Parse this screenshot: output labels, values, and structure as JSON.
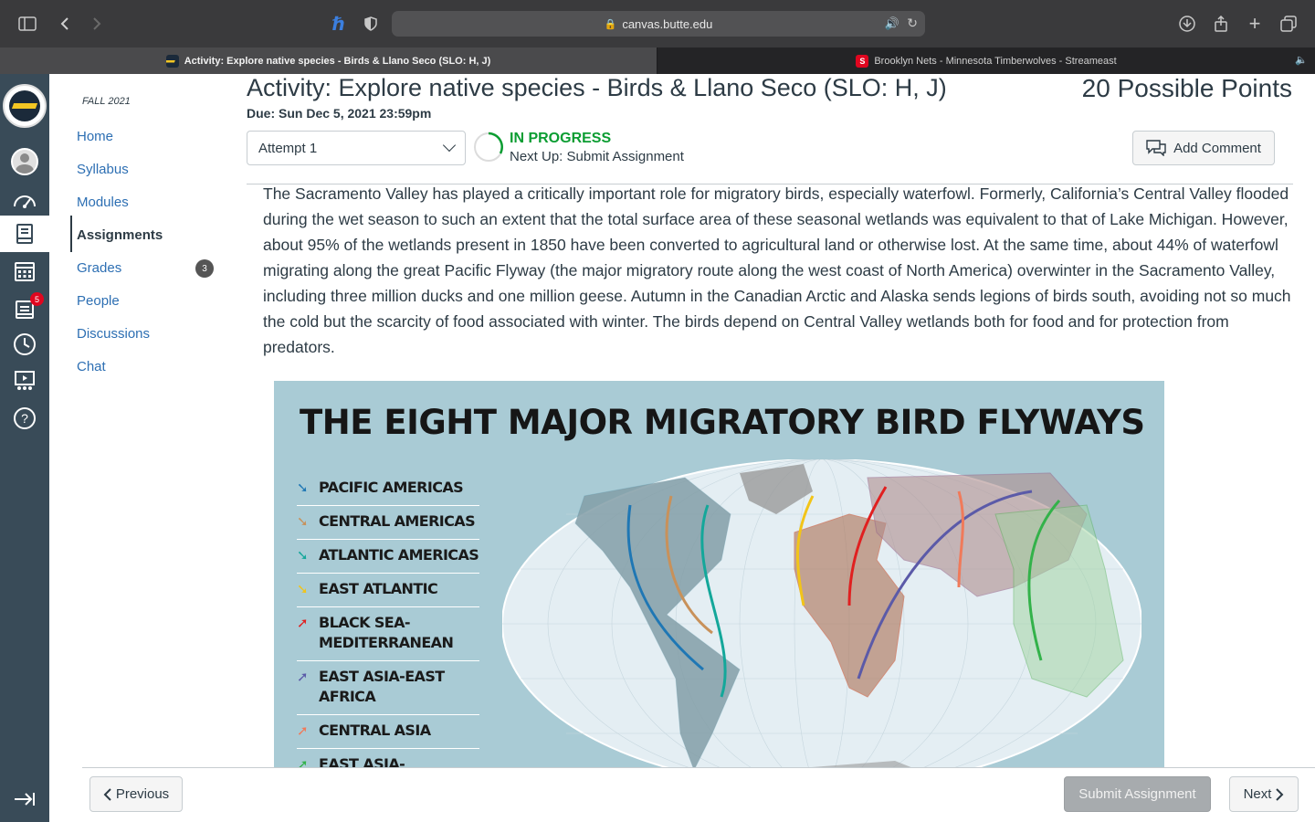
{
  "browser": {
    "url": "canvas.butte.edu",
    "tabs": [
      {
        "title": "Activity: Explore native species - Birds & Llano Seco (SLO: H, J)",
        "active": true
      },
      {
        "title": "Brooklyn Nets - Minnesota Timberwolves - Streameast",
        "active": false
      }
    ]
  },
  "global_nav": {
    "inbox_badge": "5",
    "icons": [
      "account-icon",
      "dashboard-icon",
      "courses-icon",
      "calendar-icon",
      "inbox-icon",
      "history-icon",
      "studio-icon",
      "help-icon",
      "collapse-icon"
    ]
  },
  "course_nav": {
    "term": "FALL 2021",
    "items": [
      {
        "label": "Home"
      },
      {
        "label": "Syllabus"
      },
      {
        "label": "Modules"
      },
      {
        "label": "Assignments",
        "active": true
      },
      {
        "label": "Grades",
        "badge": "3"
      },
      {
        "label": "People"
      },
      {
        "label": "Discussions"
      },
      {
        "label": "Chat"
      }
    ]
  },
  "assignment": {
    "title": "Activity: Explore native species - Birds & Llano Seco (SLO: H, J)",
    "points": "20 Possible Points",
    "due": "Due: Sun Dec 5, 2021 23:59pm",
    "attempt": "Attempt 1",
    "status": "IN PROGRESS",
    "next_up": "Next Up: Submit Assignment",
    "add_comment": "Add Comment",
    "description": "The Sacramento Valley has played a critically important role for migratory birds, especially waterfowl. Formerly, California’s Central Valley flooded during the wet season to such an extent that the total surface area of these seasonal wetlands was equivalent to that of Lake Michigan.  However, about 95% of the wetlands present in 1850 have been converted to agricultural land or otherwise lost. At the same time, about 44% of waterfowl migrating along the great Pacific Flyway (the major migratory route along the west coast of North America) overwinter in the Sacramento Valley, including three million ducks and one million geese. Autumn in the Canadian Arctic and Alaska sends legions of birds south, avoiding not so much the cold but the scarcity of food associated with winter. The birds depend on Central Valley wetlands both for food and for protection from predators."
  },
  "figure": {
    "title": "THE EIGHT MAJOR MIGRATORY BIRD FLYWAYS",
    "legend": [
      {
        "label": "PACIFIC AMERICAS",
        "color": "#1f77b4"
      },
      {
        "label": "CENTRAL AMERICAS",
        "color": "#c8915a"
      },
      {
        "label": "ATLANTIC AMERICAS",
        "color": "#14a79a"
      },
      {
        "label": "EAST ATLANTIC",
        "color": "#f2c418"
      },
      {
        "label": "BLACK SEA-\nMEDITERRANEAN",
        "color": "#e02020"
      },
      {
        "label": "EAST ASIA-EAST AFRICA",
        "color": "#5b5aa8"
      },
      {
        "label": "CENTRAL ASIA",
        "color": "#f07a5a"
      },
      {
        "label": "EAST ASIA-AUSTRALASIA",
        "color": "#33b24a"
      }
    ]
  },
  "footer": {
    "previous": "Previous",
    "submit": "Submit Assignment",
    "next": "Next"
  }
}
